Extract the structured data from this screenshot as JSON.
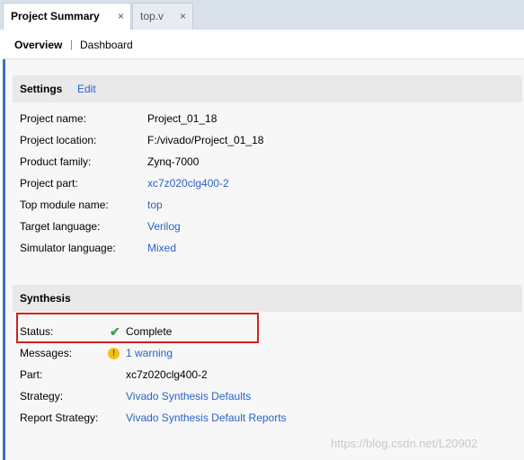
{
  "tabs": [
    {
      "label": "Project Summary",
      "close": "×"
    },
    {
      "label": "top.v",
      "close": "×"
    }
  ],
  "subtabs": {
    "overview": "Overview",
    "separator": "|",
    "dashboard": "Dashboard"
  },
  "settings": {
    "title": "Settings",
    "edit": "Edit",
    "rows": [
      {
        "label": "Project name:",
        "value": "Project_01_18"
      },
      {
        "label": "Project location:",
        "value": "F:/vivado/Project_01_18"
      },
      {
        "label": "Product family:",
        "value": "Zynq-7000"
      },
      {
        "label": "Project part:",
        "value": "xc7z020clg400-2"
      },
      {
        "label": "Top module name:",
        "value": "top"
      },
      {
        "label": "Target language:",
        "value": "Verilog"
      },
      {
        "label": "Simulator language:",
        "value": "Mixed"
      }
    ]
  },
  "synthesis": {
    "title": "Synthesis",
    "rows": [
      {
        "label": "Status:",
        "value": "Complete",
        "icon": "check-icon"
      },
      {
        "label": "Messages:",
        "value": "1 warning",
        "icon": "warning-icon"
      },
      {
        "label": "Part:",
        "value": "xc7z020clg400-2"
      },
      {
        "label": "Strategy:",
        "value": "Vivado Synthesis Defaults"
      },
      {
        "label": "Report Strategy:",
        "value": "Vivado Synthesis Default Reports"
      }
    ]
  },
  "watermark": "https://blog.csdn.net/L20902",
  "colors": {
    "link": "#2a62c9",
    "highlight": "#d61f1f",
    "check": "#36a24a",
    "warning": "#f2c21a",
    "accent": "#3f6fbf"
  }
}
